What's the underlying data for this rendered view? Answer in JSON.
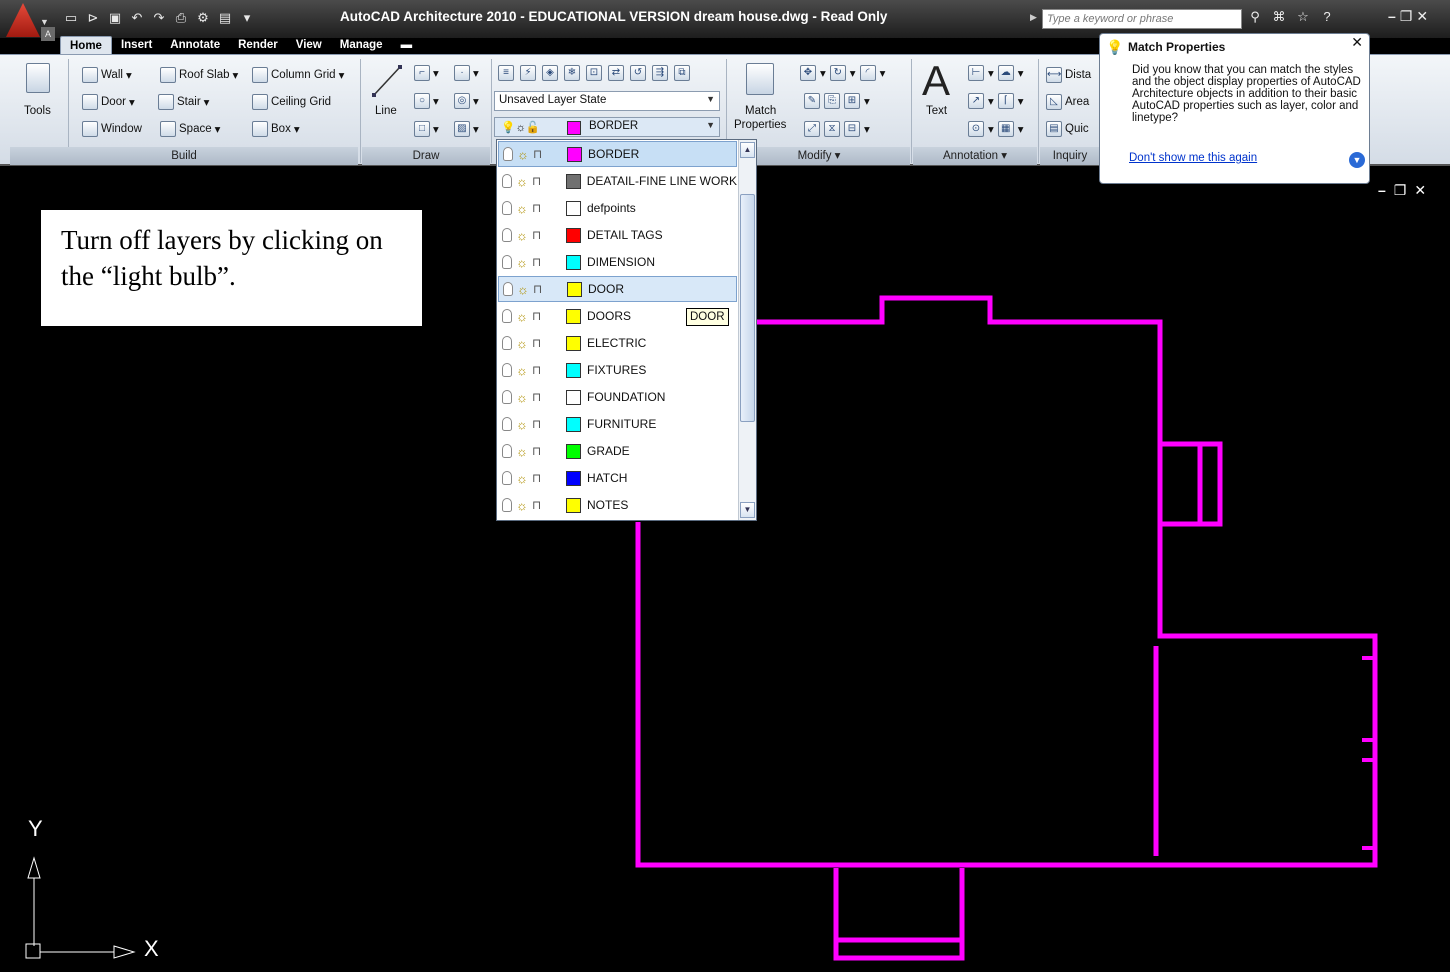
{
  "window": {
    "title": "AutoCAD Architecture 2010 - EDUCATIONAL VERSION    dream house.dwg - Read Only",
    "app_button_letter": "A",
    "search_placeholder": "Type a keyword or phrase",
    "window_controls": [
      "minimize",
      "restore",
      "close"
    ]
  },
  "quick_access": [
    "new-icon",
    "open-icon",
    "save-icon",
    "undo-icon",
    "redo-icon",
    "plot-icon",
    "workspace-icon",
    "properties-icon",
    "customize-icon"
  ],
  "tabs": [
    {
      "label": "Home",
      "active": true
    },
    {
      "label": "Insert"
    },
    {
      "label": "Annotate"
    },
    {
      "label": "Render"
    },
    {
      "label": "View"
    },
    {
      "label": "Manage"
    }
  ],
  "ribbon": {
    "tools_label": "Tools",
    "build": {
      "title": "Build",
      "wall": "Wall",
      "door": "Door",
      "window": "Window",
      "roof_slab": "Roof Slab",
      "stair": "Stair",
      "space": "Space",
      "column_grid": "Column Grid",
      "ceiling_grid": "Ceiling Grid",
      "box": "Box"
    },
    "draw": {
      "title": "Draw",
      "line": "Line"
    },
    "layers": {
      "layer_state": "Unsaved Layer State",
      "current_layer": "BORDER",
      "current_color": "#ff00ff"
    },
    "modify": {
      "title": "Modify",
      "match_properties_1": "Match",
      "match_properties_2": "Properties"
    },
    "annotation": {
      "title": "Annotation",
      "text": "Text"
    },
    "inquiry": {
      "title": "Inquiry",
      "distance": "Dista",
      "area": "Area",
      "quick": "Quic"
    }
  },
  "layer_list": {
    "selected": "BORDER",
    "hover": "DOOR",
    "rows": [
      {
        "name": "BORDER",
        "color": "#ff00ff"
      },
      {
        "name": "DEATAIL-FINE LINE WORK",
        "color": "#707070"
      },
      {
        "name": "defpoints",
        "color": "#ffffff"
      },
      {
        "name": "DETAIL TAGS",
        "color": "#ff0000"
      },
      {
        "name": "DIMENSION",
        "color": "#00ffff"
      },
      {
        "name": "DOOR",
        "color": "#ffff00"
      },
      {
        "name": "DOORS",
        "color": "#ffff00"
      },
      {
        "name": "ELECTRIC",
        "color": "#ffff00"
      },
      {
        "name": "FIXTURES",
        "color": "#00ffff"
      },
      {
        "name": "FOUNDATION",
        "color": "#ffffff"
      },
      {
        "name": "FURNITURE",
        "color": "#00ffff"
      },
      {
        "name": "GRADE",
        "color": "#00ff00"
      },
      {
        "name": "HATCH",
        "color": "#0000ff"
      },
      {
        "name": "NOTES",
        "color": "#ffff00"
      }
    ]
  },
  "tooltip": "DOOR",
  "balloon": {
    "title": "Match Properties",
    "body": "Did you know that you can match the styles and the object display properties of AutoCAD Architecture objects in addition to their basic AutoCAD properties such as layer, color and linetype?",
    "link": "Don't show me this again"
  },
  "instruction": "Turn off layers by clicking on the “light bulb”.",
  "ucs": {
    "x_label": "X",
    "y_label": "Y"
  },
  "drawing": {
    "line_color": "#ff00ff"
  }
}
